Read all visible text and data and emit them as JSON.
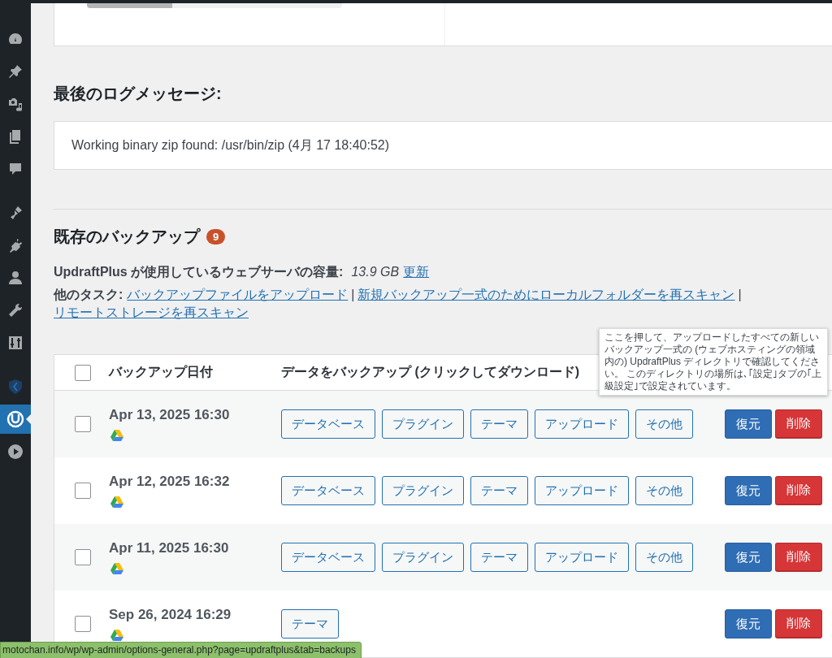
{
  "sidebar": {
    "items": [
      {
        "kind": "dashboard",
        "selected": false
      },
      {
        "kind": "pin",
        "selected": false
      },
      {
        "kind": "media",
        "selected": false
      },
      {
        "kind": "pages",
        "selected": false
      },
      {
        "kind": "comments",
        "selected": false
      },
      {
        "kind": "brush",
        "selected": false
      },
      {
        "kind": "plugin",
        "selected": false
      },
      {
        "kind": "user",
        "selected": false
      },
      {
        "kind": "wrench",
        "selected": false
      },
      {
        "kind": "sliders",
        "selected": false
      },
      {
        "kind": "shield",
        "selected": false
      },
      {
        "kind": "updraft",
        "selected": true
      },
      {
        "kind": "play",
        "selected": false
      }
    ]
  },
  "log": {
    "heading": "最後のログメッセージ:",
    "message": "Working binary zip found: /usr/bin/zip (4月 17 18:40:52)"
  },
  "backups": {
    "heading": "既存のバックアップ",
    "count": "9",
    "usage_label": "UpdraftPlus が使用しているウェブサーバの容量:",
    "usage_value": "13.9 GB",
    "refresh_link": "更新",
    "tasks_label": "他のタスク:",
    "task_separator": "|",
    "task_links": [
      "バックアップファイルをアップロード",
      "新規バックアップ一式のためにローカルフォルダーを再スキャン",
      "リモートストレージを再スキャン"
    ]
  },
  "table": {
    "select_all_checked": false,
    "columns": [
      "バックアップ日付",
      "データをバックアップ (クリックしてダウンロード)"
    ],
    "rows": [
      {
        "checked": false,
        "date": "Apr 13, 2025 16:30",
        "downloads": [
          "データベース",
          "プラグイン",
          "テーマ",
          "アップロード",
          "その他"
        ],
        "restore": "復元",
        "delete": "削除"
      },
      {
        "checked": false,
        "date": "Apr 12, 2025 16:32",
        "downloads": [
          "データベース",
          "プラグイン",
          "テーマ",
          "アップロード",
          "その他"
        ],
        "restore": "復元",
        "delete": "削除"
      },
      {
        "checked": false,
        "date": "Apr 11, 2025 16:30",
        "downloads": [
          "データベース",
          "プラグイン",
          "テーマ",
          "アップロード",
          "その他"
        ],
        "restore": "復元",
        "delete": "削除"
      },
      {
        "checked": false,
        "date": "Sep 26, 2024 16:29",
        "downloads": [
          "テーマ"
        ],
        "restore": "復元",
        "delete": "削除"
      }
    ]
  },
  "tooltip": "ここを押して、アップロードしたすべての新しいバックアップ一式の (ウェブホスティングの領域内の) UpdraftPlus ディレクトリで確認してください。 このディレクトリの場所は､｢設定｣タブの｢上級設定｣で設定されています。",
  "status_bar": "motochan.info/wp/wp-admin/options-general.php?page=updraftplus&tab=backups"
}
